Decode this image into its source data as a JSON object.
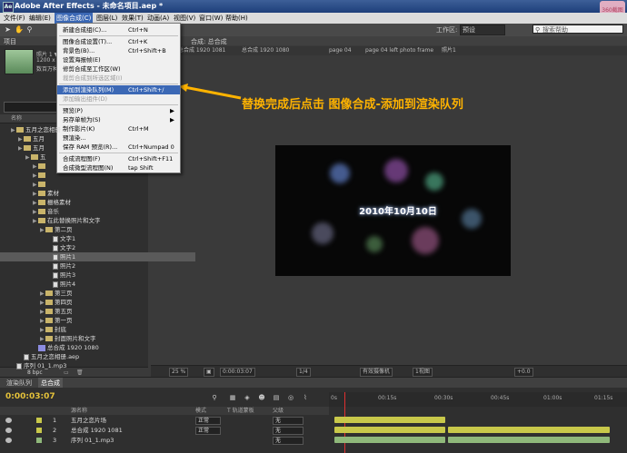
{
  "titlebar": {
    "title": "Adobe After Effects - 未命名项目.aep *",
    "watermark": "360截图"
  },
  "menubar": {
    "items": [
      "文件(F)",
      "编辑(E)",
      "图像合成(C)",
      "图层(L)",
      "效果(T)",
      "动画(A)",
      "视图(V)",
      "窗口(W)",
      "帮助(H)"
    ]
  },
  "toolbar": {
    "workspace_label": "工作区:",
    "workspace_value": "预设",
    "search_placeholder": "搜索帮助"
  },
  "project": {
    "tab": "项目",
    "meta": [
      "照片 1 ▼, 使用了 1 次",
      "1200 x 960 (1.00)",
      "数百万种颜色"
    ],
    "header_name": "名称",
    "bottom": "8 bpc",
    "tree": [
      {
        "label": "五月之恋相册",
        "type": "folder",
        "indent": 1
      },
      {
        "label": "五月",
        "type": "folder",
        "indent": 2
      },
      {
        "label": "五月",
        "type": "folder",
        "indent": 2
      },
      {
        "label": "五",
        "type": "folder",
        "indent": 3
      },
      {
        "label": "",
        "type": "folder",
        "indent": 4
      },
      {
        "label": "",
        "type": "folder",
        "indent": 4
      },
      {
        "label": "",
        "type": "folder",
        "indent": 4
      },
      {
        "label": "素材",
        "type": "folder",
        "indent": 4
      },
      {
        "label": "栅格素材",
        "type": "folder",
        "indent": 4
      },
      {
        "label": "音乐",
        "type": "folder",
        "indent": 4
      },
      {
        "label": "在此替换照片和文字",
        "type": "folder",
        "indent": 4
      },
      {
        "label": "第二页",
        "type": "folder",
        "indent": 5
      },
      {
        "label": "文字1",
        "type": "file",
        "indent": 6
      },
      {
        "label": "文字2",
        "type": "file",
        "indent": 6
      },
      {
        "label": "照片1",
        "type": "file",
        "indent": 6,
        "selected": true
      },
      {
        "label": "照片2",
        "type": "file",
        "indent": 6
      },
      {
        "label": "照片3",
        "type": "file",
        "indent": 6
      },
      {
        "label": "照片4",
        "type": "file",
        "indent": 6
      },
      {
        "label": "第三页",
        "type": "folder",
        "indent": 5
      },
      {
        "label": "第四页",
        "type": "folder",
        "indent": 5
      },
      {
        "label": "第五页",
        "type": "folder",
        "indent": 5
      },
      {
        "label": "第一页",
        "type": "folder",
        "indent": 5
      },
      {
        "label": "封底",
        "type": "folder",
        "indent": 5
      },
      {
        "label": "封面照片和文字",
        "type": "folder",
        "indent": 5
      },
      {
        "label": "总合成 1920 1080",
        "type": "comp",
        "indent": 4
      },
      {
        "label": "五月之恋相册.aep",
        "type": "file",
        "indent": 2
      },
      {
        "label": "序列 01_1.mp3",
        "type": "file",
        "indent": 1
      }
    ]
  },
  "menu": {
    "items": [
      {
        "label": "新建合成组(C)...",
        "shortcut": "Ctrl+N"
      },
      {
        "sep": true
      },
      {
        "label": "图像合成设置(T)...",
        "shortcut": "Ctrl+K"
      },
      {
        "label": "背景色(B)...",
        "shortcut": "Ctrl+Shift+B"
      },
      {
        "label": "设置海报帧(E)"
      },
      {
        "label": "修剪合成至工作区(W)"
      },
      {
        "label": "裁剪合成到所选区域(I)",
        "disabled": true
      },
      {
        "sep": true
      },
      {
        "label": "添加到渲染队列(M)",
        "shortcut": "Ctrl+Shift+/",
        "highlighted": true
      },
      {
        "label": "添加输出组件(D)",
        "disabled": true
      },
      {
        "sep": true
      },
      {
        "label": "预览(P)",
        "arrow": "▶"
      },
      {
        "label": "另存单帧为(S)",
        "arrow": "▶"
      },
      {
        "label": "制作影片(K)",
        "shortcut": "Ctrl+M"
      },
      {
        "label": "预渲染..."
      },
      {
        "label": "保存 RAM 预览(R)...",
        "shortcut": "Ctrl+Numpad 0"
      },
      {
        "sep": true
      },
      {
        "label": "合成流程图(F)",
        "shortcut": "Ctrl+Shift+F11"
      },
      {
        "label": "合成微型流程图(N)",
        "shortcut": "tap Shift"
      }
    ]
  },
  "viewer": {
    "tab": "合成: 总合成",
    "breadcrumbs": [
      "总合成 1920 1081",
      "总合成 1920 1080",
      "page 04",
      "page 04 left photo frame",
      "照片1"
    ],
    "date_text": "2010年10月10日",
    "annotation": "替换完成后点击 图像合成-添加到渲染队列",
    "bar": {
      "zoom": "25 %",
      "timecode": "0:00:03:07",
      "resolution": "1/4",
      "camera": "有效摄像机",
      "views": "1视图",
      "exposure": "+0.0"
    }
  },
  "timeline": {
    "tabs": [
      "渲染队列",
      "总合成"
    ],
    "timecode": "0:00:03:07",
    "col_name": "源名称",
    "col_mode": "模式",
    "col_track": "T 轨道蒙板",
    "col_parent": "父级",
    "ruler": [
      "0s",
      "00:15s",
      "00:30s",
      "00:45s",
      "01:00s",
      "01:15s"
    ],
    "layers": [
      {
        "num": "1",
        "name": "五月之恋片场",
        "mode": "正常",
        "parent": "无",
        "color": "#c8c84a"
      },
      {
        "num": "2",
        "name": "总合成 1920 1081",
        "mode": "正常",
        "parent": "无",
        "color": "#c8c84a"
      },
      {
        "num": "3",
        "name": "序列 01_1.mp3",
        "mode": "",
        "parent": "无",
        "color": "#8fb87a"
      }
    ]
  }
}
